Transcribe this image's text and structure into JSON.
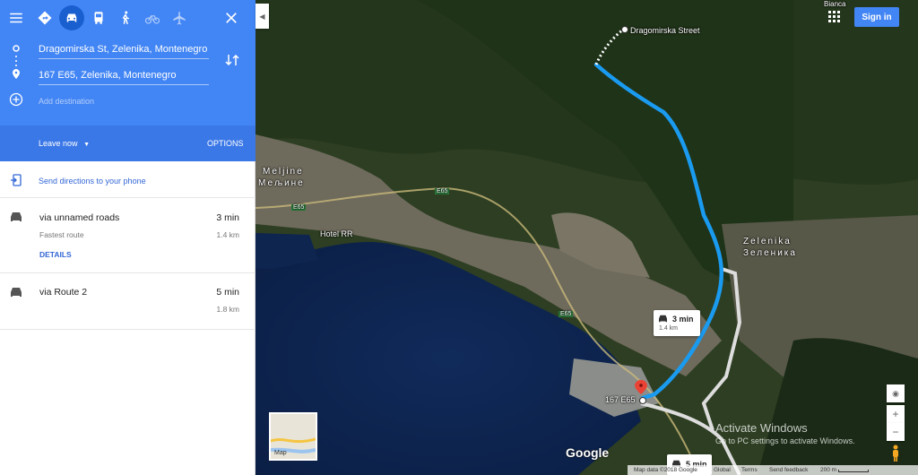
{
  "header": {
    "travel_modes": [
      {
        "name": "best-route-icon"
      },
      {
        "name": "car-icon"
      },
      {
        "name": "transit-icon"
      },
      {
        "name": "walk-icon"
      },
      {
        "name": "bike-icon"
      },
      {
        "name": "flight-icon"
      }
    ],
    "origin": "Dragomirska St, Zelenika, Montenegro",
    "destination": "167 E65, Zelenika, Montenegro",
    "add_destination_placeholder": "Add destination",
    "leave_now": "Leave now",
    "options": "OPTIONS"
  },
  "send_directions": "Send directions to your phone",
  "routes": [
    {
      "name": "via unnamed roads",
      "time": "3 min",
      "sub": "Fastest route",
      "distance": "1.4 km",
      "details": "DETAILS"
    },
    {
      "name": "via Route 2",
      "time": "5 min",
      "sub": "",
      "distance": "1.8 km"
    }
  ],
  "map": {
    "sign_in": "Sign in",
    "labels": {
      "start": "Dragomirska Street",
      "end": "167 E65",
      "melline_1": "Meljine",
      "melline_2": "Мељине",
      "zelenika_1": "Zelenika",
      "zelenika_2": "Зеленика",
      "hotel": "Hotel RR",
      "e65_a": "E65",
      "e65_b": "E65",
      "e65_c": "E65",
      "bianca": "Bianca"
    },
    "bubble1": {
      "time": "3 min",
      "dist": "1.4 km"
    },
    "bubble2": {
      "time": "5 min"
    },
    "thumb_label": "Map",
    "google": "Google",
    "activate_title": "Activate Windows",
    "activate_sub": "Go to PC settings to activate Windows.",
    "footer": {
      "data": "Map data ©2018 Google",
      "global": "Global",
      "terms": "Terms",
      "feedback": "Send feedback",
      "scale": "200 m"
    },
    "route_color": "#1a9bf0"
  }
}
